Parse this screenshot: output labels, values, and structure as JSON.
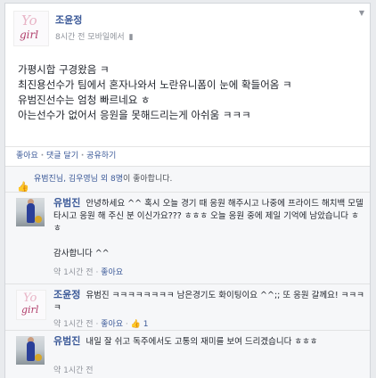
{
  "post": {
    "author": "조윤정",
    "logo_text_top": "Yo",
    "logo_text_bottom": "girl",
    "meta": "8시간 전 모바일에서",
    "lines": [
      "가평시합 구경왔음 ㅋ",
      "최진용선수가 팀에서 혼자나와서 노란유니폼이 눈에 확들어옴 ㅋ",
      "유범진선수는 엄청 빠르네요 ㅎ",
      "아는선수가 없어서 응원을 못해드리는게 아쉬움 ㅋㅋㅋ"
    ]
  },
  "actions": {
    "like": "좋아요",
    "comment": "댓글 달기",
    "share": "공유하기",
    "separator": "·"
  },
  "likes": {
    "names": "유범진님, 김우영님 외 8명",
    "suffix": "이 좋아합니다."
  },
  "comments": [
    {
      "author": "유범진",
      "text": "안녕하세요 ^^ 혹시 오늘 경기 때 응원 해주시고 나중에 프라이드 해치백 모델 타시고 응원 해 주신 분 이신가요??? ㅎㅎㅎ 오늘 응원 중에 제일 기억에 남았습니다 ㅎㅎ",
      "text2": "감사합니다 ^^",
      "time": "약 1시간 전",
      "like": "좋아요"
    },
    {
      "author": "조윤정",
      "text": "유범진 ㅋㅋㅋㅋㅋㅋㅋㅋ 남은경기도 화이팅이요 ^^;; 또 응원 갈께요! ㅋㅋㅋㅋ",
      "time": "약 1시간 전",
      "like": "좋아요",
      "like_count": "1"
    },
    {
      "author": "유범진",
      "text": "내일 잘 쉬고 독주에서도 고통의 재미를 보여 드리겠습니다 ㅎㅎㅎ",
      "time": "약 1시간 전"
    }
  ]
}
